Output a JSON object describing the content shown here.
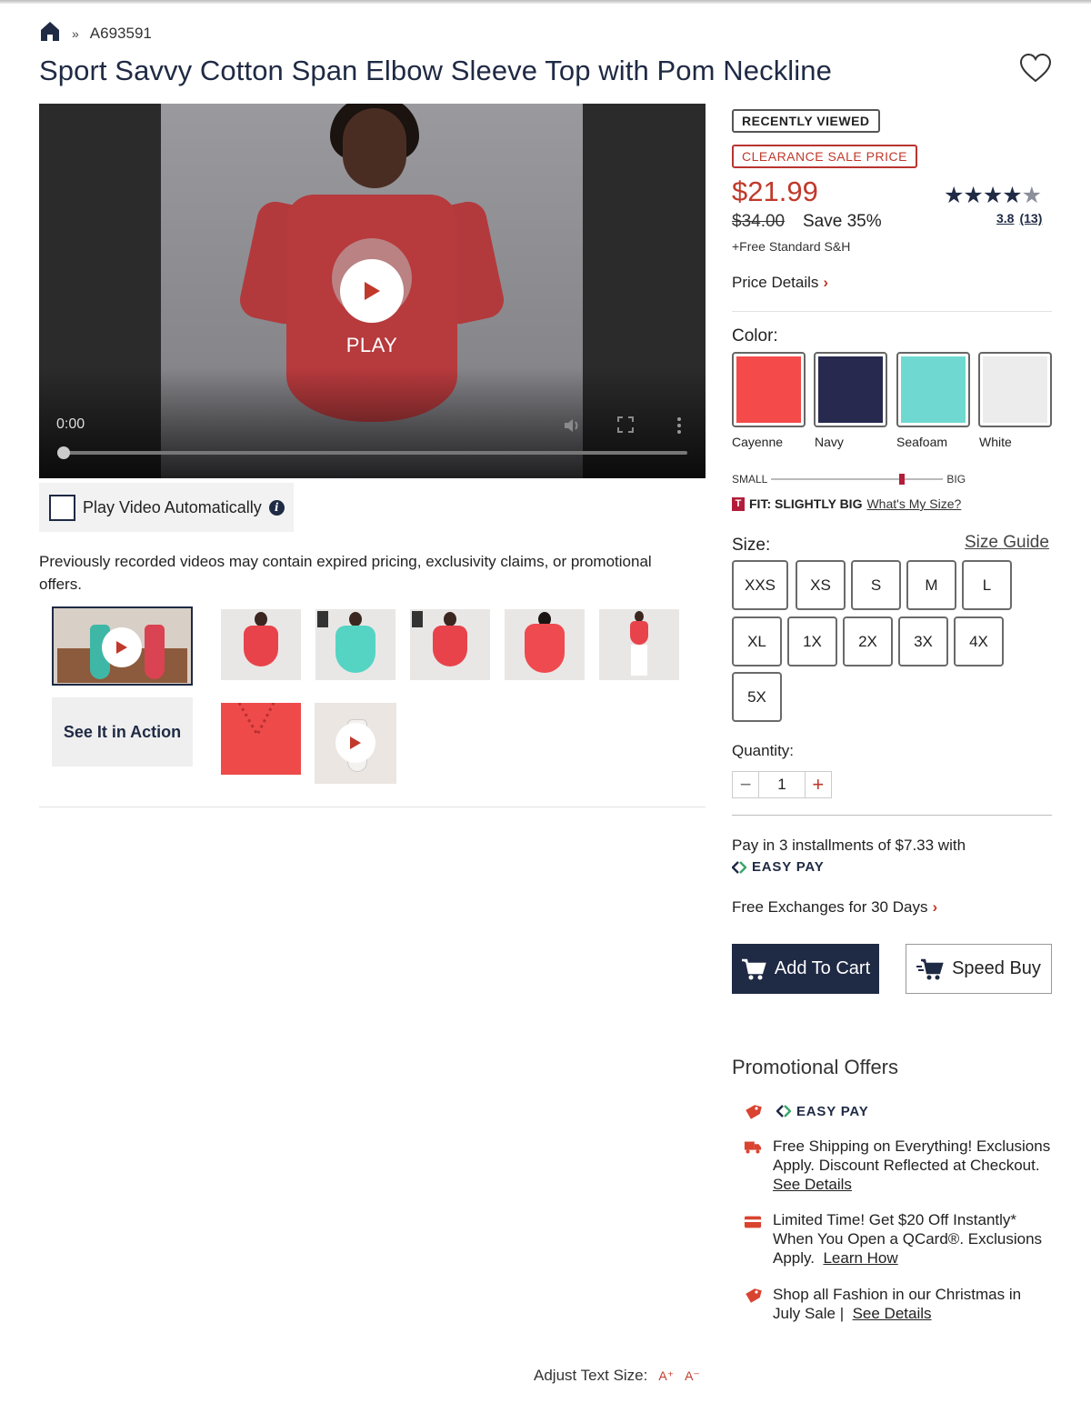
{
  "breadcrumb": {
    "separator": "»",
    "item_number": "A693591"
  },
  "product": {
    "title": "Sport Savvy Cotton Span Elbow Sleeve Top with Pom Neckline"
  },
  "video": {
    "play_label": "PLAY",
    "time": "0:00",
    "progress": 0
  },
  "autoplay": {
    "label": "Play Video Automatically",
    "info": "i"
  },
  "disclaimer": "Previously recorded videos may contain expired pricing, exclusivity claims, or promotional offers.",
  "see_it": "See It in Action",
  "badges": {
    "recent": "RECENTLY VIEWED",
    "clearance": "CLEARANCE SALE PRICE"
  },
  "pricing": {
    "price": "$21.99",
    "old_price": "$34.00",
    "save": "Save 35%",
    "shipping": "+Free Standard S&H",
    "details": "Price Details"
  },
  "rating": {
    "stars": "★★★★",
    "half_star": "★",
    "value": "3.8",
    "count": "(13)"
  },
  "color": {
    "label": "Color:",
    "swatches": [
      {
        "name": "Cayenne",
        "hex": "#f44a4a"
      },
      {
        "name": "Navy",
        "hex": "#27294f"
      },
      {
        "name": "Seafoam",
        "hex": "#6fd9d1"
      },
      {
        "name": "White",
        "hex": "#ececec"
      }
    ]
  },
  "fit": {
    "small": "SMALL",
    "big": "BIG",
    "level": 0.75,
    "badge": "T",
    "text": "FIT: SLIGHTLY BIG",
    "link": "What's My Size?"
  },
  "size": {
    "label": "Size:",
    "guide": "Size Guide",
    "options": [
      "XXS",
      "XS",
      "S",
      "M",
      "L",
      "XL",
      "1X",
      "2X",
      "3X",
      "4X",
      "5X"
    ]
  },
  "quantity": {
    "label": "Quantity:",
    "value": "1",
    "minus": "−",
    "plus": "+"
  },
  "installments": {
    "text": "Pay in 3 installments of $7.33 with",
    "easypay": "EASY PAY"
  },
  "exchanges": "Free Exchanges for 30 Days",
  "buttons": {
    "add_to_cart": "Add To Cart",
    "speed_buy": "Speed Buy"
  },
  "promotions": {
    "title": "Promotional Offers",
    "easypay": "EASY PAY",
    "shipping_text": "Free Shipping on Everything! Exclusions Apply. Discount Reflected at Checkout.",
    "shipping_link": "See Details",
    "qcard_text": "Limited Time! Get $20 Off Instantly* When You Open a QCard®. Exclusions Apply.",
    "qcard_link": "Learn How",
    "fashion_text": "Shop all Fashion in our Christmas in July Sale |",
    "fashion_link": "See Details"
  },
  "text_size": {
    "label": "Adjust Text Size:",
    "increase": "A⁺",
    "decrease": "A⁻"
  },
  "colors": {
    "navy": "#1f2a44",
    "accent_red": "#c0392b"
  }
}
